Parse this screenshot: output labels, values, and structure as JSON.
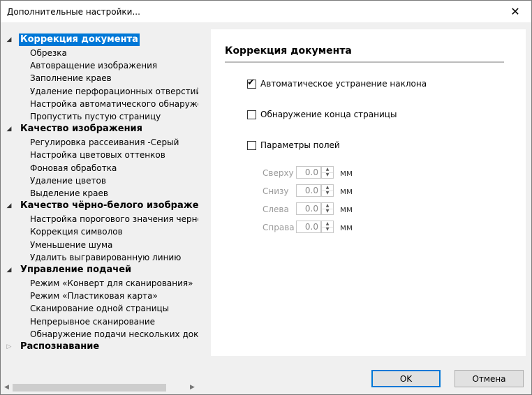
{
  "window": {
    "title": "Дополнительные настройки...",
    "close": "✕"
  },
  "tree": [
    {
      "label": "Коррекция документа",
      "expanded": true,
      "selected": true,
      "children": [
        "Обрезка",
        "Автовращение изображения",
        "Заполнение краев",
        "Удаление перфорационных отверстий",
        "Настройка автоматического обнаружения",
        "Пропустить пустую страницу"
      ]
    },
    {
      "label": "Качество изображения",
      "expanded": true,
      "children": [
        "Регулировка рассеивания -Серый",
        "Настройка цветовых оттенков",
        "Фоновая обработка",
        "Удаление цветов",
        "Выделение краев"
      ]
    },
    {
      "label": "Качество чёрно-белого изображения",
      "expanded": true,
      "children": [
        "Настройка порогового значения черно-белого",
        "Коррекция символов",
        "Уменьшение шума",
        "Удалить выгравированную линию"
      ]
    },
    {
      "label": "Управление подачей",
      "expanded": true,
      "children": [
        "Режим «Конверт для сканирования»",
        "Режим «Пластиковая карта»",
        "Сканирование одной страницы",
        "Непрерывное сканирование",
        "Обнаружение подачи нескольких документов"
      ]
    },
    {
      "label": "Распознавание",
      "expanded": false,
      "children": []
    }
  ],
  "panel": {
    "title": "Коррекция документа",
    "options": [
      {
        "label": "Автоматическое устранение наклона",
        "checked": true
      },
      {
        "label": "Обнаружение конца страницы",
        "checked": false
      },
      {
        "label": "Параметры полей",
        "checked": false
      }
    ],
    "margins": [
      {
        "label": "Сверху",
        "value": "0.0",
        "unit": "мм"
      },
      {
        "label": "Снизу",
        "value": "0.0",
        "unit": "мм"
      },
      {
        "label": "Слева",
        "value": "0.0",
        "unit": "мм"
      },
      {
        "label": "Справа",
        "value": "0.0",
        "unit": "мм"
      }
    ]
  },
  "buttons": {
    "ok": "OK",
    "cancel": "Отмена"
  },
  "icons": {
    "expanded": "◢",
    "collapsed": "▷",
    "check": "✔",
    "spin_up": "▲",
    "spin_down": "▼",
    "scroll_left": "◀",
    "scroll_right": "▶"
  },
  "colors": {
    "selection": "#0078d7",
    "disabled_text": "#9a9a9a"
  }
}
